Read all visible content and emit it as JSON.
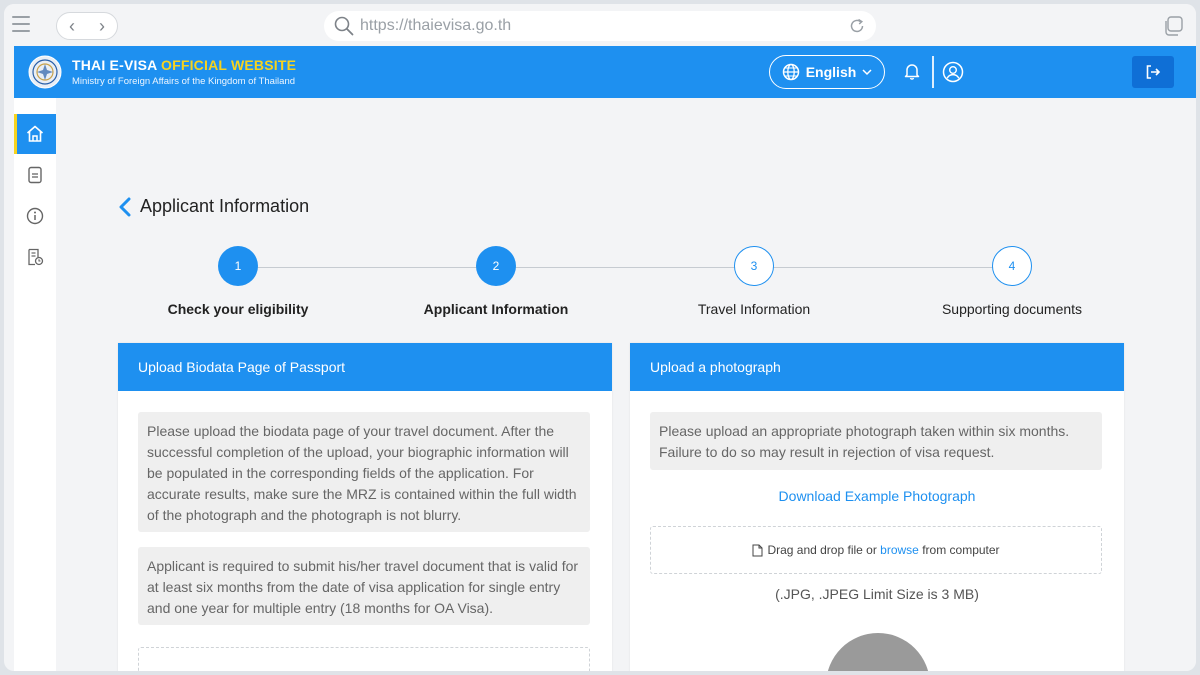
{
  "browser": {
    "url": "https://thaievisa.go.th"
  },
  "header": {
    "title_part1": "THAI E-VISA ",
    "title_part2": "OFFICIAL WEBSITE",
    "subtitle": "Ministry of Foreign Affairs of the Kingdom of Thailand",
    "language": "English"
  },
  "sidebar": {
    "items": [
      {
        "icon": "home-icon",
        "active": true
      },
      {
        "icon": "document-icon",
        "active": false
      },
      {
        "icon": "info-icon",
        "active": false
      },
      {
        "icon": "status-icon",
        "active": false
      }
    ]
  },
  "page": {
    "title": "Applicant Information"
  },
  "steps": [
    {
      "number": "1",
      "label": "Check your eligibility",
      "state": "done"
    },
    {
      "number": "2",
      "label": "Applicant Information",
      "state": "current"
    },
    {
      "number": "3",
      "label": "Travel Information",
      "state": "todo"
    },
    {
      "number": "4",
      "label": "Supporting documents",
      "state": "todo"
    }
  ],
  "passport_card": {
    "title": "Upload Biodata Page of Passport",
    "note1": "Please upload the biodata page of your travel document. After the successful completion of the upload, your biographic information will be populated in the corresponding fields of the application. For accurate results, make sure the MRZ is contained within the full width of the photograph and the photograph is not blurry.",
    "note2": "Applicant is required to submit his/her travel document that is valid for at least six months from the date of visa application for single entry and one year for multiple entry (18 months for OA Visa)."
  },
  "photo_card": {
    "title": "Upload a photograph",
    "note": "Please upload an appropriate photograph taken within six months. Failure to do so may result in rejection of visa request.",
    "download_link": "Download Example Photograph",
    "drop_text_before": "Drag and drop file or ",
    "drop_browse": "browse",
    "drop_text_after": " from computer",
    "limit": "(.JPG, .JPEG Limit Size is 3 MB)"
  },
  "colors": {
    "primary": "#1e90f0",
    "gold": "#f7d31e",
    "logout_bg": "#0f6fd6"
  }
}
